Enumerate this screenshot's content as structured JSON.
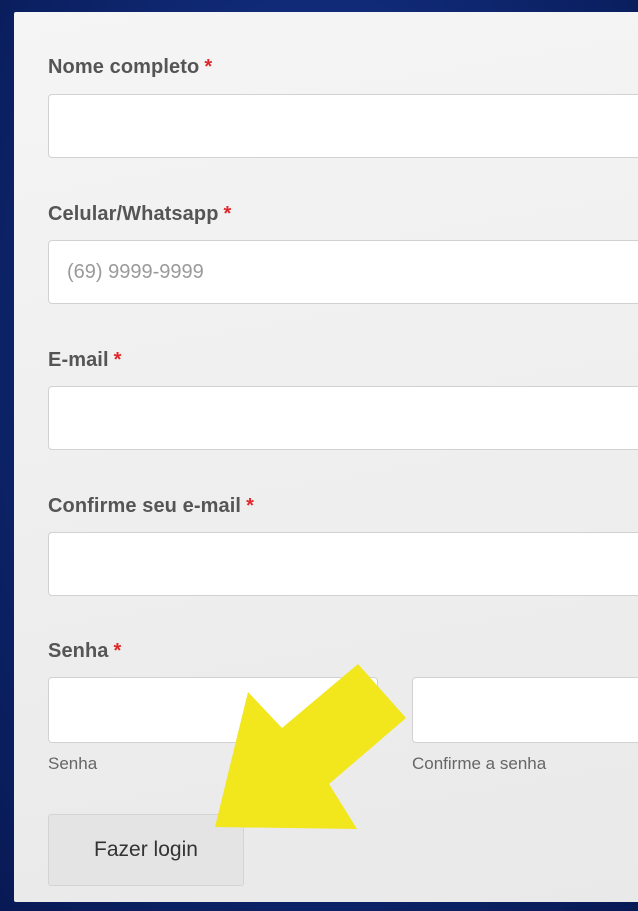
{
  "form": {
    "full_name": {
      "label": "Nome completo",
      "required_mark": "*",
      "value": "",
      "placeholder": ""
    },
    "phone": {
      "label": "Celular/Whatsapp",
      "required_mark": "*",
      "value": "",
      "placeholder": "(69) 9999-9999"
    },
    "email": {
      "label": "E-mail",
      "required_mark": "*",
      "value": "",
      "placeholder": ""
    },
    "confirm_email": {
      "label": "Confirme seu e-mail",
      "required_mark": "*",
      "value": "",
      "placeholder": ""
    },
    "password": {
      "label": "Senha",
      "required_mark": "*",
      "password_sublabel": "Senha",
      "confirm_sublabel": "Confirme a senha"
    },
    "login_button_label": "Fazer login"
  },
  "annotation": {
    "icon": "arrow-pointer-icon",
    "color": "#f2e61d"
  },
  "colors": {
    "background": "#0d2470",
    "required": "#e0262b",
    "button": "#e4e4e4"
  }
}
